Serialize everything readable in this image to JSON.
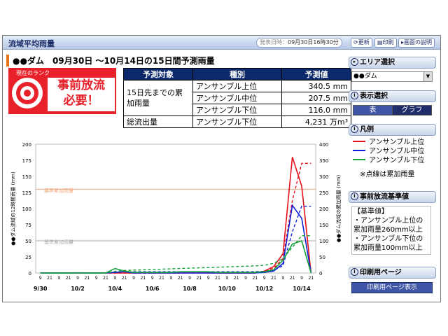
{
  "title": "流域平均雨量",
  "publish_label": "発表日時：",
  "publish_time": "09月30日16時30分",
  "toolbar": {
    "update": "更新",
    "print": "印刷",
    "help": "画面の説明"
  },
  "dam_header": "●●ダム　09月30日 ～10月14日の15日間予測雨量",
  "rank": {
    "label": "現在のランク",
    "message_line1": "事前放流",
    "message_line2": "必要！"
  },
  "forecast_table": {
    "headers": [
      "予測対象",
      "種別",
      "予測値"
    ],
    "target1": "15日先までの累加雨量",
    "rows1": [
      {
        "type": "アンサンブル上位",
        "value": "340.5",
        "unit": "mm"
      },
      {
        "type": "アンサンブル中位",
        "value": "207.5",
        "unit": "mm"
      },
      {
        "type": "アンサンブル下位",
        "value": "116.0",
        "unit": "mm"
      }
    ],
    "target2": "総流出量",
    "row2": {
      "type": "アンサンブル下位",
      "value": "4,231",
      "unit": "万m³"
    }
  },
  "panel": {
    "area_title": "エリア選択",
    "area_value": "●●ダム",
    "display_title": "表示選択",
    "table_btn": "表",
    "graph_btn": "グラフ",
    "legend_title": "凡例",
    "legend_note": "※点線は累加雨量",
    "criteria_title": "事前放流基準値",
    "criteria_head": "【基準値】",
    "criteria_items": [
      "アンサンブル上位の累加雨量260mm以上",
      "アンサンブル下位の累加雨量100mm以上"
    ],
    "print_title": "印刷用ページ",
    "print_btn": "印刷用ページ表示"
  },
  "chart_data": {
    "type": "line",
    "y_left_label": "●●ダム流域の12時間雨量 (mm)",
    "y_right_label": "●●ダム流域の累加雨量 (mm)",
    "y_left_ticks": [
      0,
      25,
      50,
      75,
      100,
      125,
      150,
      175,
      200
    ],
    "y_right_ticks": [
      0,
      50,
      100,
      150,
      200,
      250,
      300,
      350,
      400
    ],
    "ylim_left": [
      0,
      200
    ],
    "ylim_right": [
      0,
      400
    ],
    "grid": false,
    "hour_labels": [
      "9",
      "21",
      "9",
      "21",
      "9",
      "21",
      "9",
      "21",
      "9",
      "21",
      "9",
      "21",
      "9",
      "21",
      "9",
      "21",
      "9",
      "21",
      "9",
      "21",
      "9",
      "21",
      "9",
      "21",
      "9",
      "21",
      "9",
      "21",
      "9",
      "21"
    ],
    "date_labels": [
      "9/30",
      "10/2",
      "10/4",
      "10/6",
      "10/8",
      "10/10",
      "10/12",
      "10/14"
    ],
    "reference_lines": [
      {
        "label": "基準累加雨量",
        "y_right": 260,
        "color": "#f3a67a"
      },
      {
        "label": "基準累加雨量",
        "y_right": 100,
        "color": "#aaaaaa"
      }
    ],
    "series": [
      {
        "name": "アンサンブル上位",
        "color": "#e8101c",
        "values": [
          0,
          0,
          0,
          0,
          0,
          0,
          0,
          0,
          0,
          0,
          0,
          0,
          0,
          0,
          0,
          0,
          0,
          0,
          0,
          0,
          0,
          0,
          0,
          0,
          3,
          10,
          30,
          180,
          135,
          0
        ],
        "cumulative": [
          0,
          0,
          0,
          0,
          0,
          0,
          0,
          0,
          0,
          0,
          0,
          0,
          0,
          0,
          0,
          0,
          0,
          0,
          0,
          0,
          0,
          0,
          0,
          0,
          5,
          15,
          45,
          225,
          340.5,
          340.5
        ]
      },
      {
        "name": "アンサンブル中位",
        "color": "#1020d8",
        "values": [
          0,
          0,
          0,
          0,
          0,
          0,
          0,
          0,
          1,
          2,
          0,
          0,
          0,
          0,
          0,
          0,
          0,
          0,
          0,
          0,
          0,
          0,
          0,
          0,
          1,
          3,
          15,
          105,
          85,
          0
        ],
        "cumulative": [
          0,
          0,
          0,
          0,
          0,
          0,
          0,
          0,
          2,
          4,
          4,
          4,
          4,
          4,
          4,
          4,
          4,
          4,
          4,
          4,
          4,
          4,
          4,
          4,
          5,
          8,
          23,
          128,
          207.5,
          207.5
        ]
      },
      {
        "name": "アンサンブル下位",
        "color": "#16a33a",
        "values": [
          0,
          0,
          0,
          0,
          0,
          0,
          0,
          0,
          7,
          3,
          1,
          1,
          1,
          1,
          1,
          2,
          2,
          2,
          2,
          1,
          1,
          1,
          1,
          1,
          2,
          5,
          20,
          45,
          50,
          0
        ],
        "cumulative": [
          0,
          0,
          0,
          0,
          0,
          0,
          0,
          0,
          5,
          8,
          9,
          10,
          11,
          12,
          13,
          14,
          15,
          16,
          17,
          18,
          19,
          20,
          21,
          22,
          24,
          30,
          45,
          80,
          116,
          116
        ]
      }
    ]
  }
}
